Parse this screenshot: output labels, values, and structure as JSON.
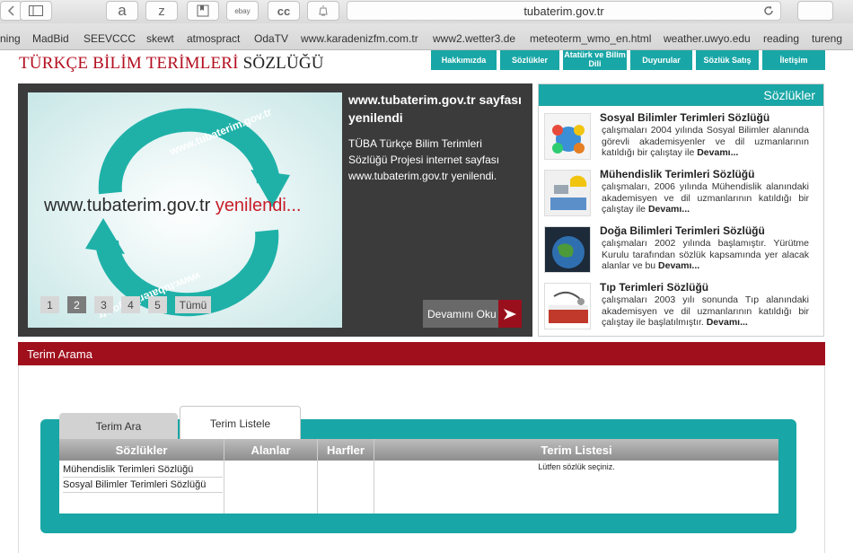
{
  "browser": {
    "url": "tubaterim.gov.tr",
    "toolbar_buttons": [
      "a",
      "z",
      "ebay",
      "cc"
    ],
    "bookmarks": [
      "ning",
      "MadBid",
      "SEEVCCC",
      "skewt",
      "atmospract",
      "OdaTV",
      "www.karadenizfm.com.tr",
      "www2.wetter3.de",
      "meteoterm_wmo_en.html",
      "weather.uwyo.edu",
      "reading",
      "tureng"
    ]
  },
  "site": {
    "title_red": "TÜRKÇE BİLİM TERİMLERİ",
    "title_dark": "SÖZLÜĞÜ"
  },
  "nav": {
    "items": [
      "Hakkımızda",
      "Sözlükler",
      "Atatürk ve Bilim Dili",
      "Duyurular",
      "Sözlük Satış",
      "İletişim"
    ]
  },
  "slider": {
    "image_text": "www.tubaterim.gov.tr",
    "image_text_red": "yenilendi...",
    "title": "www.tubaterim.gov.tr sayfası yenilendi",
    "description": "TÜBA Türkçe Bilim Terimleri Sözlüğü Projesi internet sayfası www.tubaterim.gov.tr yenilendi.",
    "pages": [
      "1",
      "2",
      "3",
      "4",
      "5",
      "Tümü"
    ],
    "active_page": "2",
    "read_more": "Devamını Oku"
  },
  "dictionaries": {
    "header": "Sözlükler",
    "items": [
      {
        "title": "Sosyal Bilimler Terimleri Sözlüğü",
        "desc": "çalışmaları 2004 yılında Sosyal Bilimler alanında görevli akademisyenler ve dil uzmanlarının katıldığı bir çalıştay ile",
        "more": "Devamı..."
      },
      {
        "title": "Mühendislik Terimleri Sözlüğü",
        "desc": "çalışmaları, 2006 yılında Mühendislik alanındaki akademisyen ve dil uzmanlarının katıldığı bir çalıştay ile",
        "more": "Devamı..."
      },
      {
        "title": "Doğa Bilimleri Terimleri Sözlüğü",
        "desc": "çalışmaları 2002 yılında başlamıştır. Yürütme Kurulu tarafından sözlük kapsamında yer alacak alanlar ve bu",
        "more": "Devamı..."
      },
      {
        "title": "Tıp Terimleri Sözlüğü",
        "desc": "çalışmaları 2003 yılı sonunda Tıp alanındaki akademisyen ve dil uzmanlarının katıldığı bir çalıştay ile başlatılmıştır.",
        "more": "Devamı..."
      }
    ]
  },
  "search": {
    "bar_title": "Terim Arama",
    "tabs": [
      "Terim Ara",
      "Terim Listele"
    ],
    "columns": [
      "Sözlükler",
      "Alanlar",
      "Harfler",
      "Terim Listesi"
    ],
    "dictionary_rows": [
      "Mühendislik Terimleri Sözlüğü",
      "Sosyal Bilimler Terimleri Sözlüğü"
    ],
    "list_message": "Lütfen sözlük seçiniz."
  },
  "colors": {
    "teal": "#19a6a6",
    "brand_red": "#a00f1c",
    "slider_bg": "#3b3b3b"
  }
}
